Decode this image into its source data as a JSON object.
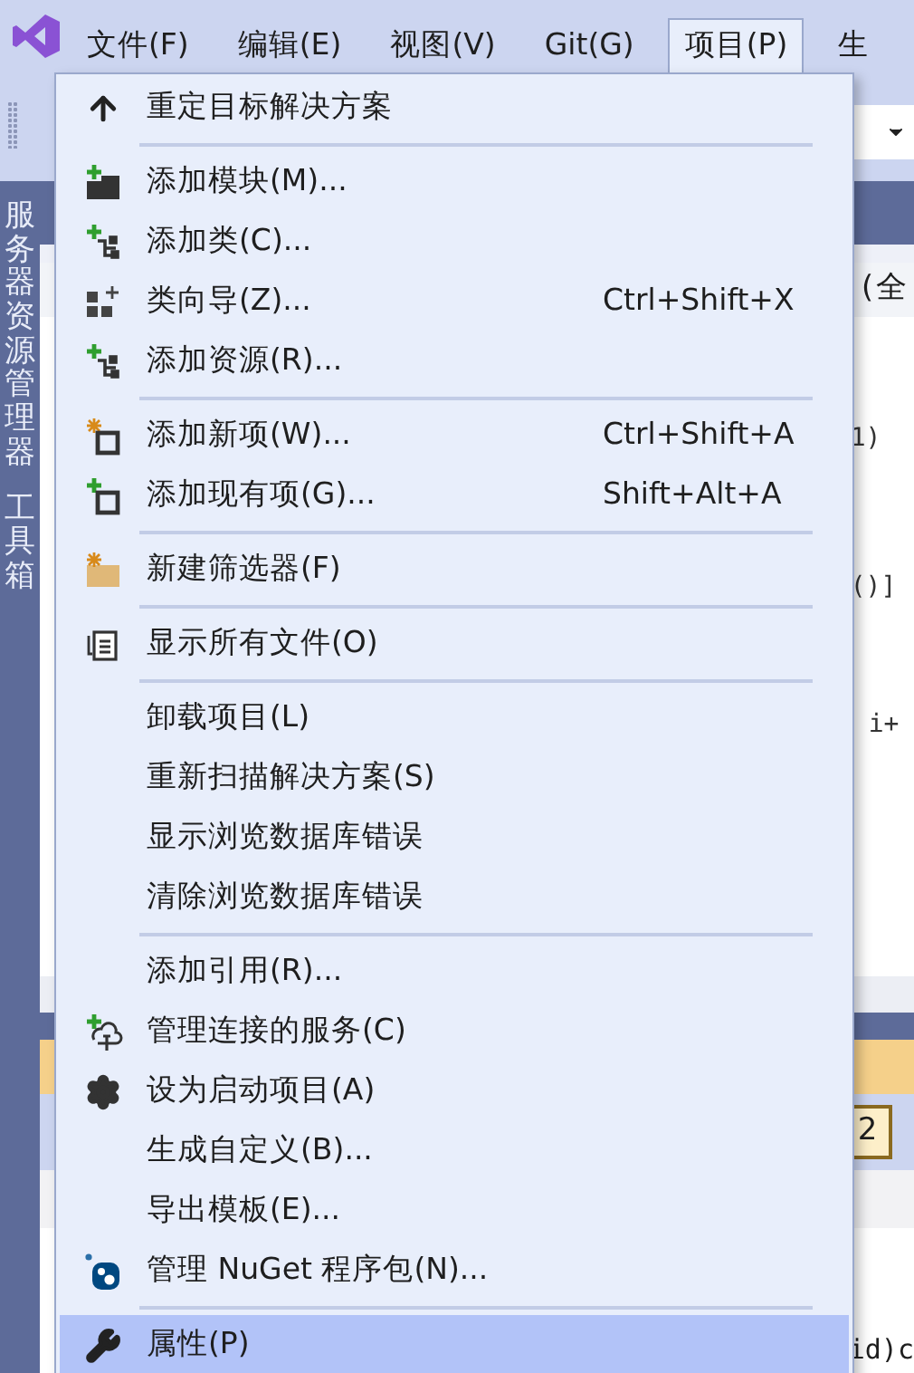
{
  "menubar": [
    {
      "label": "文件(F)",
      "selected": false
    },
    {
      "label": "编辑(E)",
      "selected": false
    },
    {
      "label": "视图(V)",
      "selected": false
    },
    {
      "label": "Git(G)",
      "selected": false
    },
    {
      "label": "项目(P)",
      "selected": true
    },
    {
      "label": "生",
      "selected": false
    }
  ],
  "sidebar": {
    "tabs": [
      "服务器资源管理器",
      "工具箱"
    ]
  },
  "editor_fragments": [
    "(全",
    "1)",
    "()]",
    "i+",
    "2",
    "id)c"
  ],
  "menu": {
    "items": [
      {
        "kind": "item",
        "label": "重定目标解决方案",
        "selected": false
      },
      {
        "kind": "separator"
      },
      {
        "kind": "item",
        "label": "添加模块(M)...",
        "selected": false
      },
      {
        "kind": "item",
        "label": "添加类(C)...",
        "selected": false
      },
      {
        "kind": "item",
        "label": "类向导(Z)...",
        "shortcut": "Ctrl+Shift+X",
        "selected": false
      },
      {
        "kind": "item",
        "label": "添加资源(R)...",
        "selected": false
      },
      {
        "kind": "separator"
      },
      {
        "kind": "item",
        "label": "添加新项(W)...",
        "shortcut": "Ctrl+Shift+A",
        "selected": false
      },
      {
        "kind": "item",
        "label": "添加现有项(G)...",
        "shortcut": "Shift+Alt+A",
        "selected": false
      },
      {
        "kind": "separator"
      },
      {
        "kind": "item",
        "label": "新建筛选器(F)",
        "selected": false
      },
      {
        "kind": "separator"
      },
      {
        "kind": "item",
        "label": "显示所有文件(O)",
        "selected": false
      },
      {
        "kind": "separator"
      },
      {
        "kind": "item",
        "label": "卸载项目(L)",
        "selected": false
      },
      {
        "kind": "item",
        "label": "重新扫描解决方案(S)",
        "selected": false
      },
      {
        "kind": "item",
        "label": "显示浏览数据库错误",
        "selected": false
      },
      {
        "kind": "item",
        "label": "清除浏览数据库错误",
        "selected": false
      },
      {
        "kind": "separator"
      },
      {
        "kind": "item",
        "label": "添加引用(R)...",
        "selected": false
      },
      {
        "kind": "item",
        "label": "管理连接的服务(C)",
        "selected": false
      },
      {
        "kind": "item",
        "label": "设为启动项目(A)",
        "selected": false
      },
      {
        "kind": "item",
        "label": "生成自定义(B)...",
        "selected": false
      },
      {
        "kind": "item",
        "label": "导出模板(E)...",
        "selected": false
      },
      {
        "kind": "item",
        "label": "管理 NuGet 程序包(N)...",
        "selected": false
      },
      {
        "kind": "separator"
      },
      {
        "kind": "item",
        "label": "属性(P)",
        "selected": true
      }
    ]
  }
}
